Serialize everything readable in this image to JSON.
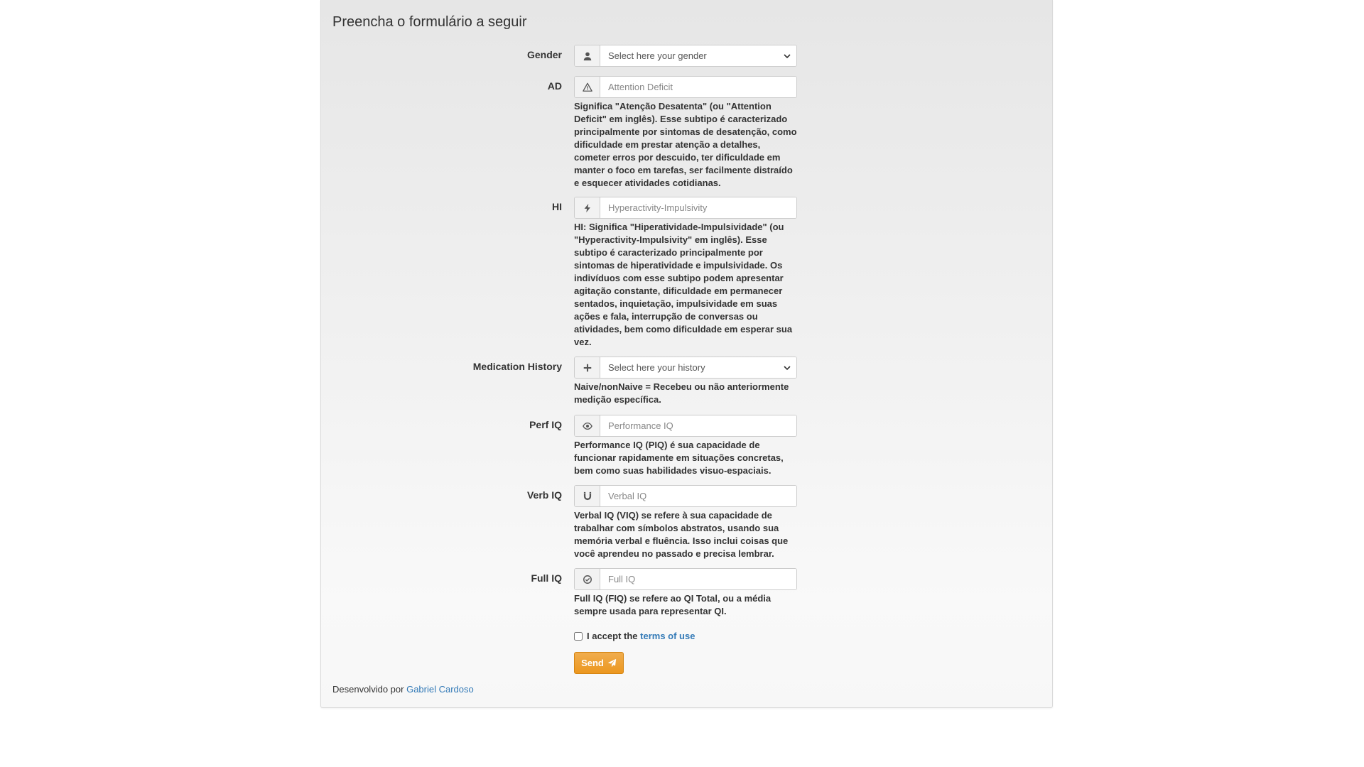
{
  "form": {
    "title": "Preencha o formulário a seguir",
    "gender": {
      "label": "Gender",
      "icon": "user-icon",
      "selected": "Select here your gender"
    },
    "ad": {
      "label": "AD",
      "icon": "warning-icon",
      "placeholder": "Attention Deficit",
      "help": "Significa \"Atenção Desatenta\" (ou \"Attention Deficit\" em inglês). Esse subtipo é caracterizado principalmente por sintomas de desatenção, como dificuldade em prestar atenção a detalhes, cometer erros por descuido, ter dificuldade em manter o foco em tarefas, ser facilmente distraído e esquecer atividades cotidianas."
    },
    "hi": {
      "label": "HI",
      "icon": "flash-icon",
      "placeholder": "Hyperactivity-Impulsivity",
      "help": "HI: Significa \"Hiperatividade-Impulsividade\" (ou \"Hyperactivity-Impulsivity\" em inglês). Esse subtipo é caracterizado principalmente por sintomas de hiperatividade e impulsividade. Os indivíduos com esse subtipo podem apresentar agitação constante, dificuldade em permanecer sentados, inquietação, impulsividade em suas ações e fala, interrupção de conversas ou atividades, bem como dificuldade em esperar sua vez."
    },
    "medication": {
      "label": "Medication History",
      "icon": "plus-icon",
      "selected": "Select here your history",
      "help": "Naive/nonNaive = Recebeu ou não anteriormente medição específica."
    },
    "perf_iq": {
      "label": "Perf IQ",
      "icon": "eye-icon",
      "placeholder": "Performance IQ",
      "help": "Performance IQ (PIQ) é sua capacidade de funcionar rapidamente em situações concretas, bem como suas habilidades visuo-espaciais."
    },
    "verb_iq": {
      "label": "Verb IQ",
      "icon": "magnet-icon",
      "placeholder": "Verbal IQ",
      "help": "Verbal IQ (VIQ) se refere à sua capacidade de trabalhar com símbolos abstratos, usando sua memória verbal e fluência. Isso inclui coisas que você aprendeu no passado e precisa lembrar."
    },
    "full_iq": {
      "label": "Full IQ",
      "icon": "check-circle-icon",
      "placeholder": "Full IQ",
      "help": "Full IQ (FIQ) se refere ao QI Total, ou a média sempre usada para representar QI."
    },
    "terms": {
      "prefix": "I accept the",
      "link": "terms of use",
      "checked": false
    },
    "send_label": "Send",
    "send_icon": "send-icon"
  },
  "footer": {
    "prefix": "Desenvolvido por",
    "author": "Gabriel Cardoso"
  },
  "colors": {
    "accent": "#f0ad4e",
    "link": "#337ab7"
  }
}
